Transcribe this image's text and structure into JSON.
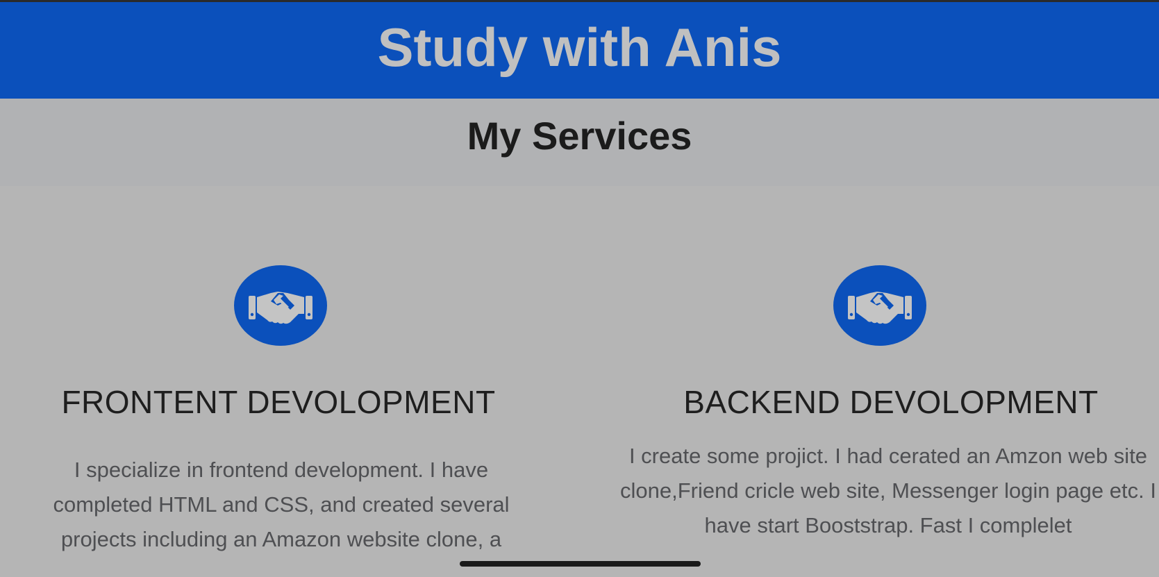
{
  "header": {
    "title": "Study with Anis",
    "background": "#0b50bb"
  },
  "services_section": {
    "heading": "My Services",
    "items": [
      {
        "icon": "handshake-icon",
        "title": "FRONTENT DEVOLOPMENT",
        "description": "I specialize in frontend development. I have completed HTML and CSS, and created several projects including an Amazon website clone, a"
      },
      {
        "icon": "handshake-icon",
        "title": "BACKEND DEVOLOPMENT",
        "description": "I create some projict. I had cerated an Amzon web site clone,Friend cricle web site, Messenger login page etc. I have start Booststrap. Fast I complelet"
      }
    ]
  },
  "colors": {
    "accent": "#0b50bb",
    "page_background": "#b5b5b5",
    "title_text": "#c0c0c0"
  }
}
